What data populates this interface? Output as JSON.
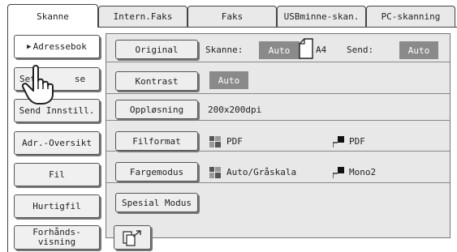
{
  "tabs": [
    "Skanne",
    "Intern.Faks",
    "Faks",
    "USBminne-skan.",
    "PC-skanning"
  ],
  "sidebar": {
    "address_book": "Adressebok",
    "settings_partial_left": "Set",
    "settings_partial_right": "se",
    "send_settings": "Send Innstill.",
    "address_overview": "Adr.-Oversikt",
    "file": "Fil",
    "quick_file": "Hurtigfil",
    "preview_line1": "Forhånds-",
    "preview_line2": "visning"
  },
  "rows": {
    "original": {
      "button": "Original",
      "scan_label": "Skanne:",
      "scan_value": "Auto",
      "paper": "A4",
      "send_label": "Send:",
      "send_value": "Auto"
    },
    "contrast": {
      "button": "Kontrast",
      "value": "Auto"
    },
    "resolution": {
      "button": "Oppløsning",
      "value": "200x200dpi"
    },
    "file_format": {
      "button": "Filformat",
      "color_value": "PDF",
      "mono_value": "PDF"
    },
    "color_mode": {
      "button": "Fargemodus",
      "color_value": "Auto/Gråskala",
      "mono_value": "Mono2"
    },
    "special_mode": {
      "button": "Spesial Modus"
    }
  },
  "colors": {
    "badge": "#8a8a8a",
    "panel": "#e8e8e8"
  },
  "icons": [
    "pointing-hand-icon",
    "color-mode-icon",
    "mono-mode-icon",
    "paper-a4-icon",
    "send-file-icon"
  ]
}
